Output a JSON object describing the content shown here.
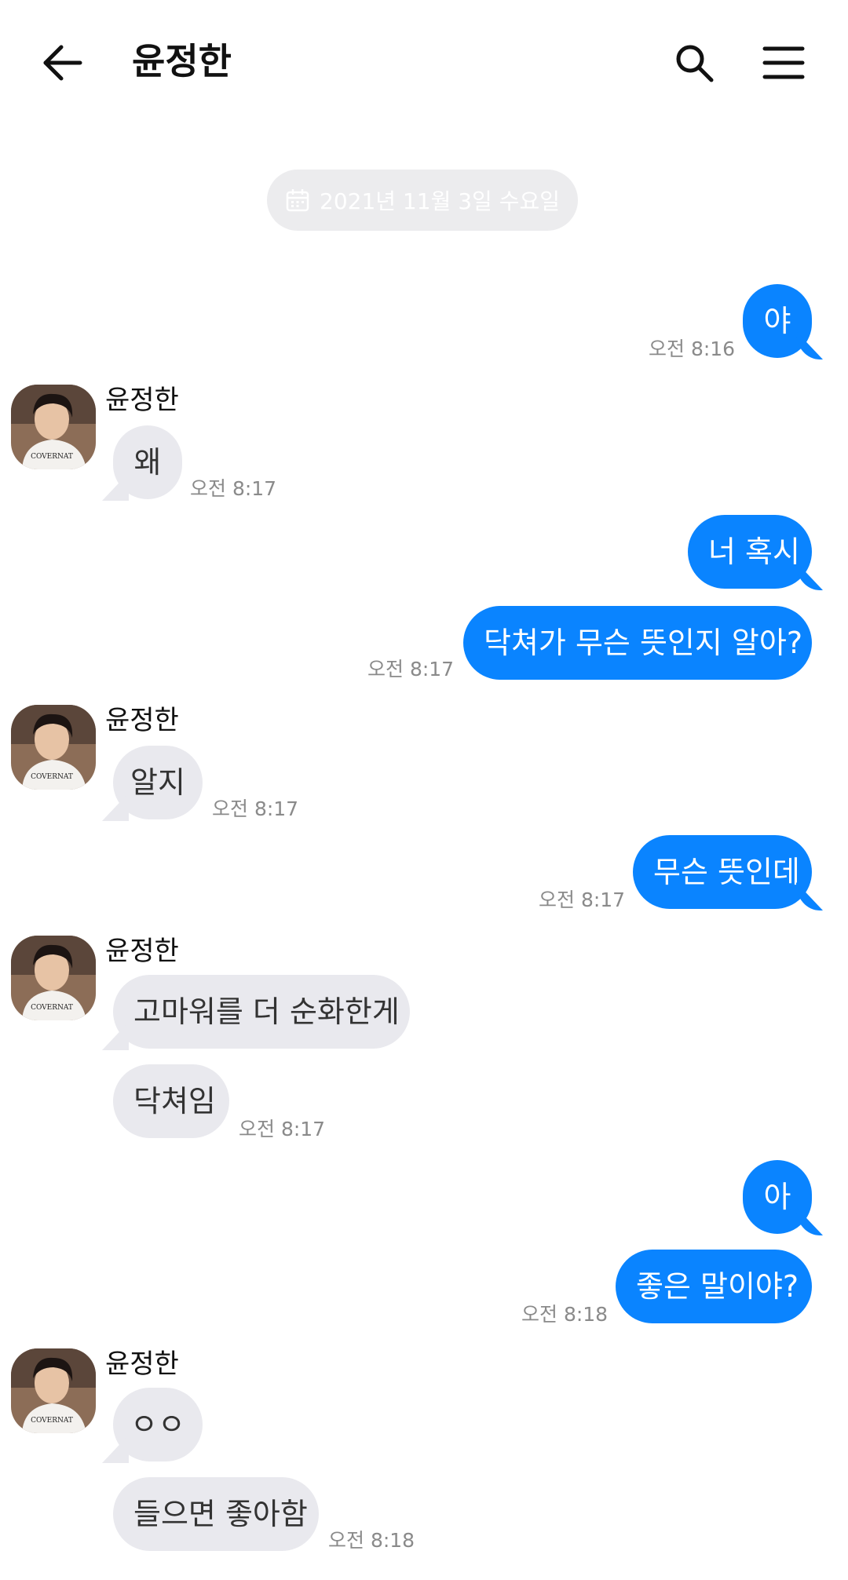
{
  "header": {
    "title": "윤정한"
  },
  "date_chip": {
    "label": "2021년 11월 3일 수요일"
  },
  "colors": {
    "outgoing_bubble": "#0a84ff",
    "incoming_bubble": "#e9e9ee",
    "date_chip": "#ececee"
  },
  "messages": [
    {
      "side": "out",
      "text": "야",
      "time": "오전 8:16"
    },
    {
      "side": "in",
      "sender": "윤정한",
      "text": "왜",
      "time": "오전 8:17"
    },
    {
      "side": "out",
      "text": "너 혹시"
    },
    {
      "side": "out",
      "text": "닥쳐가 무슨 뜻인지 알아?",
      "time": "오전 8:17"
    },
    {
      "side": "in",
      "sender": "윤정한",
      "text": "알지",
      "time": "오전 8:17"
    },
    {
      "side": "out",
      "text": "무슨 뜻인데",
      "time": "오전 8:17"
    },
    {
      "side": "in",
      "sender": "윤정한",
      "text": "고마워를 더 순화한게"
    },
    {
      "side": "in",
      "text": "닥쳐임",
      "time": "오전 8:17"
    },
    {
      "side": "out",
      "text": "아"
    },
    {
      "side": "out",
      "text": "좋은 말이야?",
      "time": "오전 8:18"
    },
    {
      "side": "in",
      "sender": "윤정한",
      "text": "ㅇㅇ"
    },
    {
      "side": "in",
      "text": "들으면 좋아함",
      "time": "오전 8:18"
    }
  ]
}
